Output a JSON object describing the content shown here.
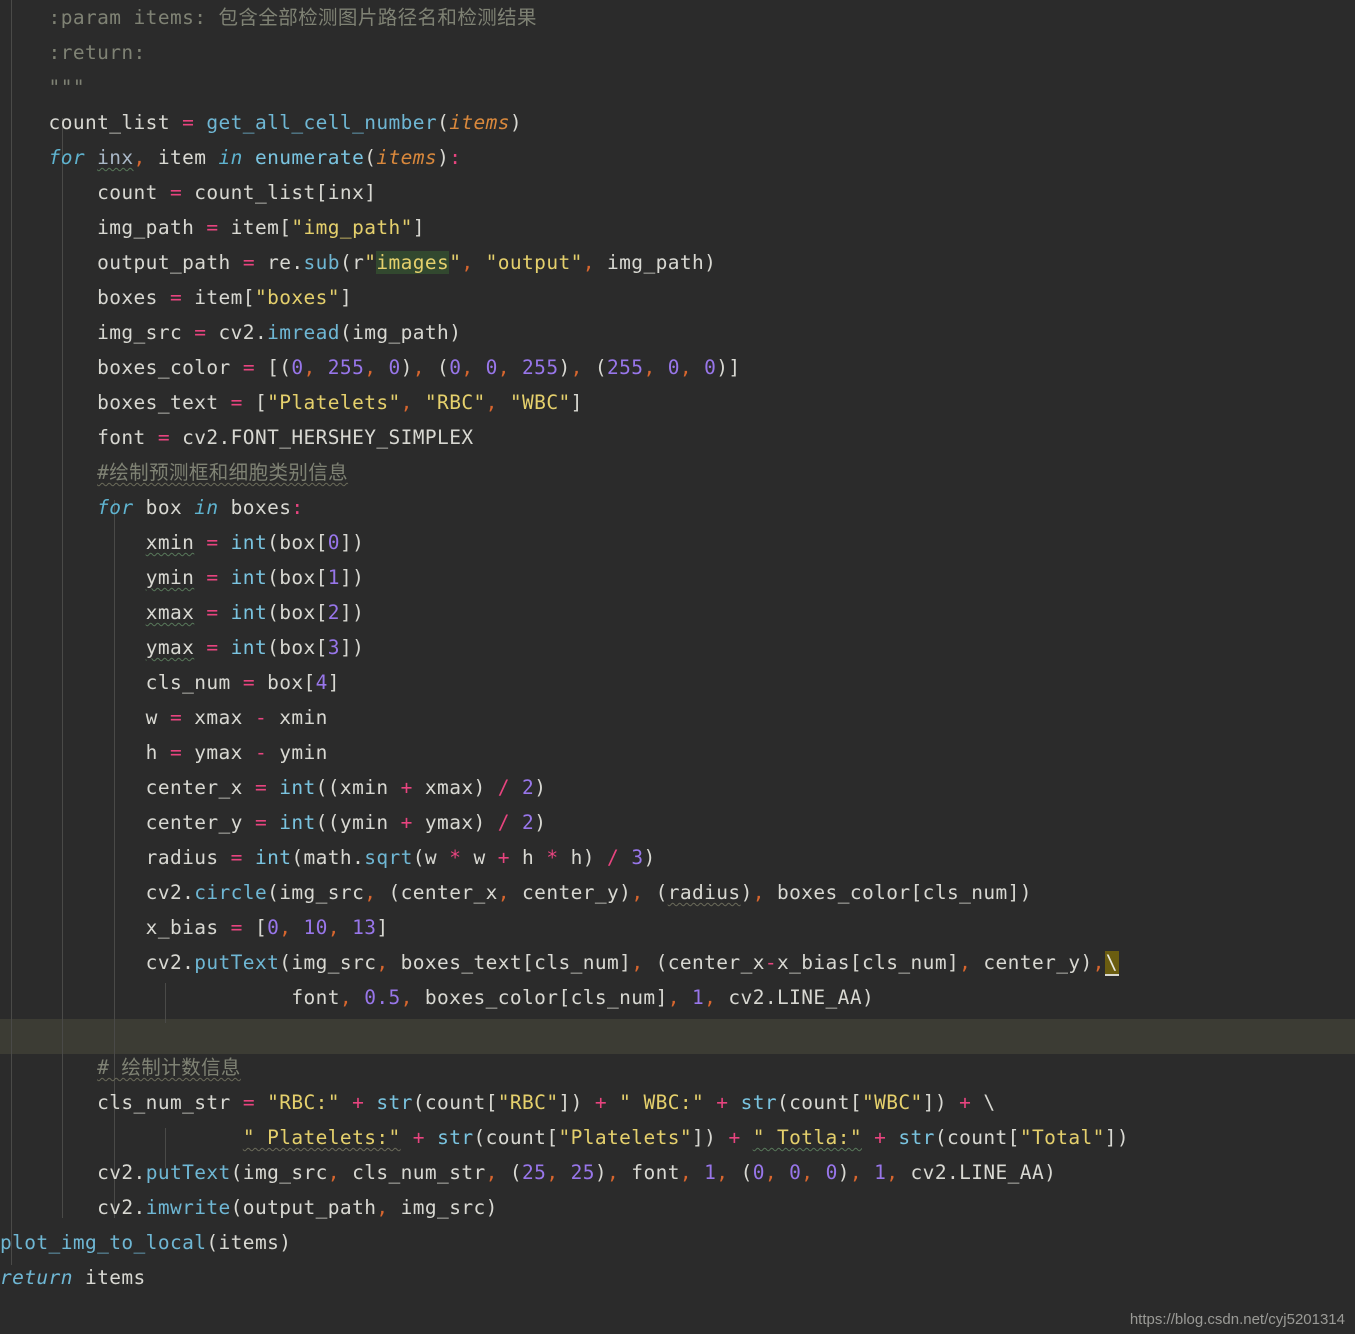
{
  "editor": {
    "theme_name": "darcula",
    "background_color": "#2b2b2b",
    "default_text_color": "#a9b7c6",
    "highlighted_line_color": "#3c3c34",
    "search_match_color": "#32482f",
    "continuation_highlight_color": "#6b5d10",
    "language": "python",
    "line_height_px": 35,
    "font_size_px": 19.5
  },
  "watermark": {
    "text": "https://blog.csdn.net/cyj5201314"
  },
  "code": {
    "lines": [
      {
        "n": 1,
        "indent": 4,
        "text": ":param items: 包含全部检测图片路径名和检测结果"
      },
      {
        "n": 2,
        "indent": 4,
        "text": ":return:"
      },
      {
        "n": 3,
        "indent": 4,
        "text": "\"\"\""
      },
      {
        "n": 4,
        "indent": 4,
        "text": "count_list = get_all_cell_number(items)"
      },
      {
        "n": 5,
        "indent": 4,
        "text": "for inx, item in enumerate(items):"
      },
      {
        "n": 6,
        "indent": 8,
        "text": "count = count_list[inx]"
      },
      {
        "n": 7,
        "indent": 8,
        "text": "img_path = item[\"img_path\"]"
      },
      {
        "n": 8,
        "indent": 8,
        "text": "output_path = re.sub(r\"images\", \"output\", img_path)"
      },
      {
        "n": 9,
        "indent": 8,
        "text": "boxes = item[\"boxes\"]"
      },
      {
        "n": 10,
        "indent": 8,
        "text": "img_src = cv2.imread(img_path)"
      },
      {
        "n": 11,
        "indent": 8,
        "text": "boxes_color = [(0, 255, 0), (0, 0, 255), (255, 0, 0)]"
      },
      {
        "n": 12,
        "indent": 8,
        "text": "boxes_text = [\"Platelets\", \"RBC\", \"WBC\"]"
      },
      {
        "n": 13,
        "indent": 8,
        "text": "font = cv2.FONT_HERSHEY_SIMPLEX"
      },
      {
        "n": 14,
        "indent": 8,
        "text": "#绘制预测框和细胞类别信息"
      },
      {
        "n": 15,
        "indent": 8,
        "text": "for box in boxes:"
      },
      {
        "n": 16,
        "indent": 12,
        "text": "xmin = int(box[0])"
      },
      {
        "n": 17,
        "indent": 12,
        "text": "ymin = int(box[1])"
      },
      {
        "n": 18,
        "indent": 12,
        "text": "xmax = int(box[2])"
      },
      {
        "n": 19,
        "indent": 12,
        "text": "ymax = int(box[3])"
      },
      {
        "n": 20,
        "indent": 12,
        "text": "cls_num = box[4]"
      },
      {
        "n": 21,
        "indent": 12,
        "text": "w = xmax - xmin"
      },
      {
        "n": 22,
        "indent": 12,
        "text": "h = ymax - ymin"
      },
      {
        "n": 23,
        "indent": 12,
        "text": "center_x = int((xmin + xmax) / 2)"
      },
      {
        "n": 24,
        "indent": 12,
        "text": "center_y = int((ymin + ymax) / 2)"
      },
      {
        "n": 25,
        "indent": 12,
        "text": "radius = int(math.sqrt(w * w + h * h) / 3)"
      },
      {
        "n": 26,
        "indent": 12,
        "text": "cv2.circle(img_src, (center_x, center_y), (radius), boxes_color[cls_num])"
      },
      {
        "n": 27,
        "indent": 12,
        "text": "x_bias = [0, 10, 13]"
      },
      {
        "n": 28,
        "indent": 12,
        "text": "cv2.putText(img_src, boxes_text[cls_num], (center_x-x_bias[cls_num], center_y), \\"
      },
      {
        "n": 29,
        "indent": 24,
        "text": "font, 0.5, boxes_color[cls_num], 1, cv2.LINE_AA)"
      },
      {
        "n": 30,
        "indent": 0,
        "text": ""
      },
      {
        "n": 31,
        "indent": 8,
        "text": "# 绘制计数信息"
      },
      {
        "n": 32,
        "indent": 8,
        "text": "cls_num_str = \"RBC:\" + str(count[\"RBC\"]) + \" WBC:\" + str(count[\"WBC\"]) + \\"
      },
      {
        "n": 33,
        "indent": 20,
        "text": "\" Platelets:\" + str(count[\"Platelets\"]) + \" Totla:\" + str(count[\"Total\"])"
      },
      {
        "n": 34,
        "indent": 8,
        "text": "cv2.putText(img_src, cls_num_str, (25, 25), font, 1, (0, 0, 0), 1, cv2.LINE_AA)"
      },
      {
        "n": 35,
        "indent": 8,
        "text": "cv2.imwrite(output_path, img_src)"
      },
      {
        "n": 36,
        "indent": 0,
        "text": "plot_img_to_local(items)"
      },
      {
        "n": 37,
        "indent": 0,
        "text": "return items"
      }
    ],
    "docstring_params": {
      "param_name": "items",
      "param_desc": "包含全部检测图片路径名和检测结果",
      "return_tag": ":return:"
    },
    "comments": [
      "#绘制预测框和细胞类别信息",
      "# 绘制计数信息"
    ],
    "string_literals": [
      "img_path",
      "images",
      "output",
      "boxes",
      "Platelets",
      "RBC",
      "WBC",
      "RBC:",
      " WBC:",
      " Platelets:",
      " Totla:",
      "Total"
    ],
    "numeric_literals": [
      "0",
      "255",
      "0",
      "0",
      "0",
      "255",
      "255",
      "0",
      "0",
      "0",
      "1",
      "2",
      "3",
      "4",
      "2",
      "2",
      "3",
      "0",
      "10",
      "13",
      "0.5",
      "1",
      "25",
      "25",
      "1",
      "0",
      "0",
      "0",
      "1"
    ],
    "functions_called": [
      "get_all_cell_number",
      "enumerate",
      "re.sub",
      "cv2.imread",
      "int",
      "math.sqrt",
      "cv2.circle",
      "cv2.putText",
      "str",
      "cv2.imwrite",
      "plot_img_to_local"
    ],
    "constants_referenced": [
      "cv2.FONT_HERSHEY_SIMPLEX",
      "cv2.LINE_AA"
    ],
    "keywords": [
      "for",
      "in",
      "return"
    ],
    "search_match_token": "images",
    "highlighted_continuation_token": "\\",
    "spellcheck_flagged": [
      "xmin",
      "ymin",
      "xmax",
      "ymax",
      "Totla",
      "cls_num",
      "inx",
      "Platelets"
    ]
  }
}
